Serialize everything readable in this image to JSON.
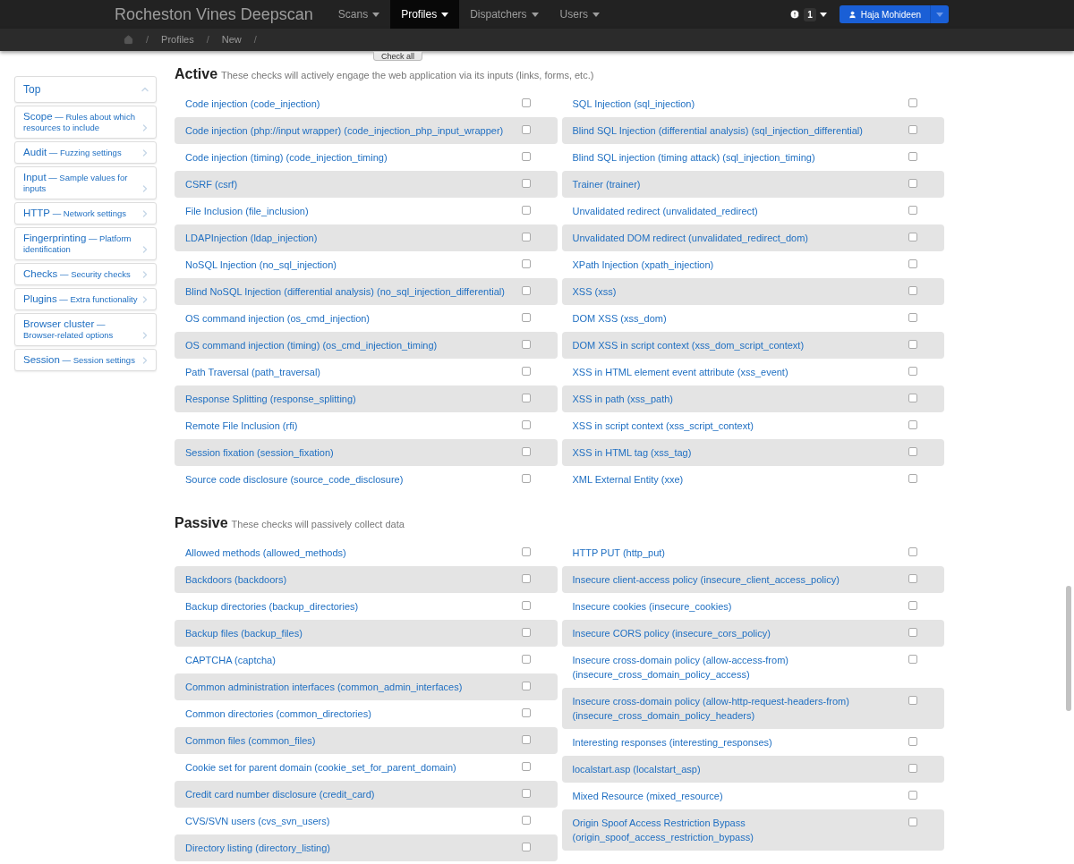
{
  "navbar": {
    "brand": "Rocheston Vines Deepscan",
    "menus": [
      {
        "label": "Scans",
        "selected": false
      },
      {
        "label": "Profiles",
        "selected": true
      },
      {
        "label": "Dispatchers",
        "selected": false
      },
      {
        "label": "Users",
        "selected": false
      }
    ],
    "notifications": {
      "count": "1"
    },
    "user": {
      "name": "Haja Mohideen"
    }
  },
  "breadcrumb": [
    {
      "kind": "separator",
      "text": "/"
    },
    {
      "kind": "link",
      "text": "Profiles"
    },
    {
      "kind": "separator",
      "text": "/"
    },
    {
      "kind": "link",
      "text": "New"
    },
    {
      "kind": "separator",
      "text": "/"
    }
  ],
  "check_all_button": "Check all",
  "sidebar": {
    "items": [
      {
        "kind": "top",
        "title": "Top"
      },
      {
        "kind": "section",
        "title": "Scope",
        "description": "— Rules about which resources to include"
      },
      {
        "kind": "section",
        "title": "Audit",
        "description": "— Fuzzing settings"
      },
      {
        "kind": "section",
        "title": "Input",
        "description": "— Sample values for inputs"
      },
      {
        "kind": "section",
        "title": "HTTP",
        "description": "— Network settings"
      },
      {
        "kind": "section",
        "title": "Fingerprinting",
        "description": "— Platform identification"
      },
      {
        "kind": "section",
        "title": "Checks",
        "description": "— Security checks"
      },
      {
        "kind": "section",
        "title": "Plugins",
        "description": "— Extra functionality"
      },
      {
        "kind": "section",
        "title": "Browser cluster",
        "description": "— Browser-related options"
      },
      {
        "kind": "section",
        "title": "Session",
        "description": "— Session settings"
      }
    ]
  },
  "sections": [
    {
      "title": "Active",
      "description": "These checks will actively engage the web application via its inputs (links, forms, etc.)",
      "columns": [
        [
          {
            "label": "Code injection (code_injection)",
            "checked": false
          },
          {
            "label": "Code injection (php://input wrapper) (code_injection_php_input_wrapper)",
            "checked": false
          },
          {
            "label": "Code injection (timing) (code_injection_timing)",
            "checked": false
          },
          {
            "label": "CSRF (csrf)",
            "checked": false
          },
          {
            "label": "File Inclusion (file_inclusion)",
            "checked": false
          },
          {
            "label": "LDAPInjection (ldap_injection)",
            "checked": false
          },
          {
            "label": "NoSQL Injection (no_sql_injection)",
            "checked": false
          },
          {
            "label": "Blind NoSQL Injection (differential analysis) (no_sql_injection_differential)",
            "checked": false
          },
          {
            "label": "OS command injection (os_cmd_injection)",
            "checked": false
          },
          {
            "label": "OS command injection (timing) (os_cmd_injection_timing)",
            "checked": false
          },
          {
            "label": "Path Traversal (path_traversal)",
            "checked": false
          },
          {
            "label": "Response Splitting (response_splitting)",
            "checked": false
          },
          {
            "label": "Remote File Inclusion (rfi)",
            "checked": false
          },
          {
            "label": "Session fixation (session_fixation)",
            "checked": false
          },
          {
            "label": "Source code disclosure (source_code_disclosure)",
            "checked": false
          }
        ],
        [
          {
            "label": "SQL Injection (sql_injection)",
            "checked": false
          },
          {
            "label": "Blind SQL Injection (differential analysis) (sql_injection_differential)",
            "checked": false
          },
          {
            "label": "Blind SQL injection (timing attack) (sql_injection_timing)",
            "checked": false
          },
          {
            "label": "Trainer (trainer)",
            "checked": false
          },
          {
            "label": "Unvalidated redirect (unvalidated_redirect)",
            "checked": false
          },
          {
            "label": "Unvalidated DOM redirect (unvalidated_redirect_dom)",
            "checked": false
          },
          {
            "label": "XPath Injection (xpath_injection)",
            "checked": false
          },
          {
            "label": "XSS (xss)",
            "checked": false
          },
          {
            "label": "DOM XSS (xss_dom)",
            "checked": false
          },
          {
            "label": "DOM XSS in script context (xss_dom_script_context)",
            "checked": false
          },
          {
            "label": "XSS in HTML element event attribute (xss_event)",
            "checked": false
          },
          {
            "label": "XSS in path (xss_path)",
            "checked": false
          },
          {
            "label": "XSS in script context (xss_script_context)",
            "checked": false
          },
          {
            "label": "XSS in HTML tag (xss_tag)",
            "checked": false
          },
          {
            "label": "XML External Entity (xxe)",
            "checked": false
          }
        ]
      ]
    },
    {
      "title": "Passive",
      "description": "These checks will passively collect data",
      "columns": [
        [
          {
            "label": "Allowed methods (allowed_methods)",
            "checked": false
          },
          {
            "label": "Backdoors (backdoors)",
            "checked": false
          },
          {
            "label": "Backup directories (backup_directories)",
            "checked": false
          },
          {
            "label": "Backup files (backup_files)",
            "checked": false
          },
          {
            "label": "CAPTCHA (captcha)",
            "checked": false
          },
          {
            "label": "Common administration interfaces (common_admin_interfaces)",
            "checked": false
          },
          {
            "label": "Common directories (common_directories)",
            "checked": false
          },
          {
            "label": "Common files (common_files)",
            "checked": false
          },
          {
            "label": "Cookie set for parent domain (cookie_set_for_parent_domain)",
            "checked": false
          },
          {
            "label": "Credit card number disclosure (credit_card)",
            "checked": false
          },
          {
            "label": "CVS/SVN users (cvs_svn_users)",
            "checked": false
          },
          {
            "label": "Directory listing (directory_listing)",
            "checked": false
          }
        ],
        [
          {
            "label": "HTTP PUT (http_put)",
            "checked": false
          },
          {
            "label": "Insecure client-access policy (insecure_client_access_policy)",
            "checked": false
          },
          {
            "label": "Insecure cookies (insecure_cookies)",
            "checked": false
          },
          {
            "label": "Insecure CORS policy (insecure_cors_policy)",
            "checked": false
          },
          {
            "label": "Insecure cross-domain policy (allow-access-from) (insecure_cross_domain_policy_access)",
            "checked": false
          },
          {
            "label": "Insecure cross-domain policy (allow-http-request-headers-from) (insecure_cross_domain_policy_headers)",
            "checked": false
          },
          {
            "label": "Interesting responses (interesting_responses)",
            "checked": false
          },
          {
            "label": "localstart.asp (localstart_asp)",
            "checked": false
          },
          {
            "label": "Mixed Resource (mixed_resource)",
            "checked": false
          },
          {
            "label": "Origin Spoof Access Restriction Bypass (origin_spoof_access_restriction_bypass)",
            "checked": false
          }
        ]
      ]
    }
  ]
}
